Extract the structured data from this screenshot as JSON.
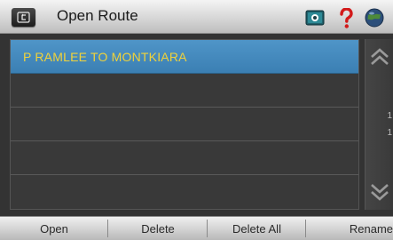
{
  "header": {
    "title": "Open Route",
    "back_icon": "back-arrow-icon",
    "icons": [
      "camera-icon",
      "help-icon",
      "globe-icon"
    ],
    "help_color": "#d21a1a"
  },
  "routes": [
    {
      "label": "P RAMLEE TO MONTKIARA",
      "selected": true
    },
    {
      "label": "",
      "selected": false
    },
    {
      "label": "",
      "selected": false
    },
    {
      "label": "",
      "selected": false
    },
    {
      "label": "",
      "selected": false
    }
  ],
  "scroll": {
    "page_current": "1",
    "page_total": "1"
  },
  "bottom": {
    "open": "Open",
    "delete": "Delete",
    "delete_all": "Delete All",
    "rename": "Rename"
  },
  "colors": {
    "selected_row": "#4a8fc2",
    "route_text": "#f0d23a"
  }
}
